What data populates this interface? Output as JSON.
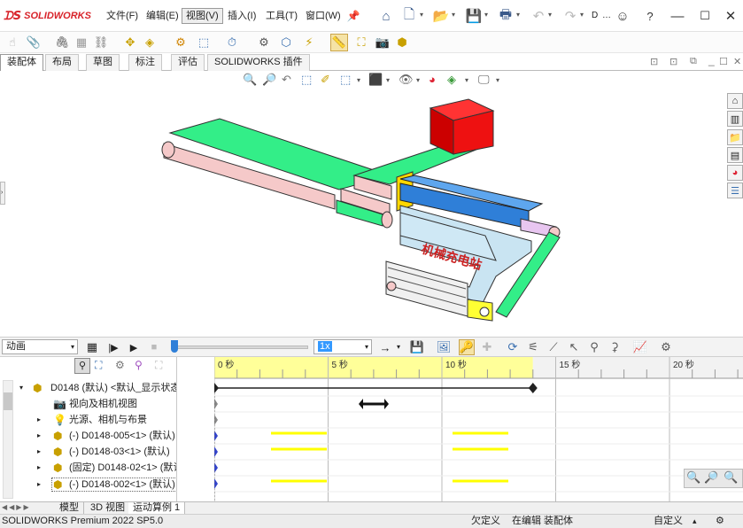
{
  "app": {
    "brand": "SOLIDWORKS",
    "doc_short": "D"
  },
  "menus": [
    {
      "label": "文件(F)",
      "name": "menu-file"
    },
    {
      "label": "编辑(E)",
      "name": "menu-edit"
    },
    {
      "label": "视图(V)",
      "name": "menu-view"
    },
    {
      "label": "插入(I)",
      "name": "menu-insert"
    },
    {
      "label": "工具(T)",
      "name": "menu-tools"
    },
    {
      "label": "窗口(W)",
      "name": "menu-window"
    }
  ],
  "cmd_tabs": [
    "装配体",
    "布局",
    "草图",
    "标注",
    "评估",
    "SOLIDWORKS 插件"
  ],
  "motion": {
    "study_type": "动画",
    "speed_value": "1x"
  },
  "timeline": {
    "ticks": [
      "0 秒",
      "5 秒",
      "10 秒",
      "15 秒",
      "20 秒"
    ],
    "key_end_seconds": 14,
    "highlight_end_seconds": 14
  },
  "tree": {
    "root": "D0148 (默认) <默认_显示状态",
    "items": [
      {
        "label": "视向及相机视图",
        "icon": "camera-icon"
      },
      {
        "label": "光源、相机与布景",
        "icon": "light-icon"
      },
      {
        "label": "(-) D0148-005<1> (默认)",
        "icon": "part-icon"
      },
      {
        "label": "(-) D0148-03<1> (默认)",
        "icon": "part-icon"
      },
      {
        "label": "(固定) D0148-02<1> (默认",
        "icon": "part-icon"
      },
      {
        "label": "(-) D0148-002<1> (默认)",
        "icon": "part-icon"
      }
    ]
  },
  "bottom_tabs": [
    "模型",
    "3D 视图",
    "运动算例 1"
  ],
  "status": {
    "product": "SOLIDWORKS Premium 2022 SP5.0",
    "state": "欠定义",
    "editing": "在编辑 装配体",
    "custom": "自定义"
  },
  "model": {
    "watermark": "机械充电站"
  },
  "colors": {
    "brand_red": "#d8232a",
    "belt_green": "#33ee88",
    "belt_pink": "#f5c9c9",
    "box_red": "#ee1111",
    "cylinder_blue": "#2f7fd8",
    "frame_lightblue": "#c9e4f2",
    "timeline_yellow": "#ffff99",
    "key_yellow": "#ffff00"
  }
}
